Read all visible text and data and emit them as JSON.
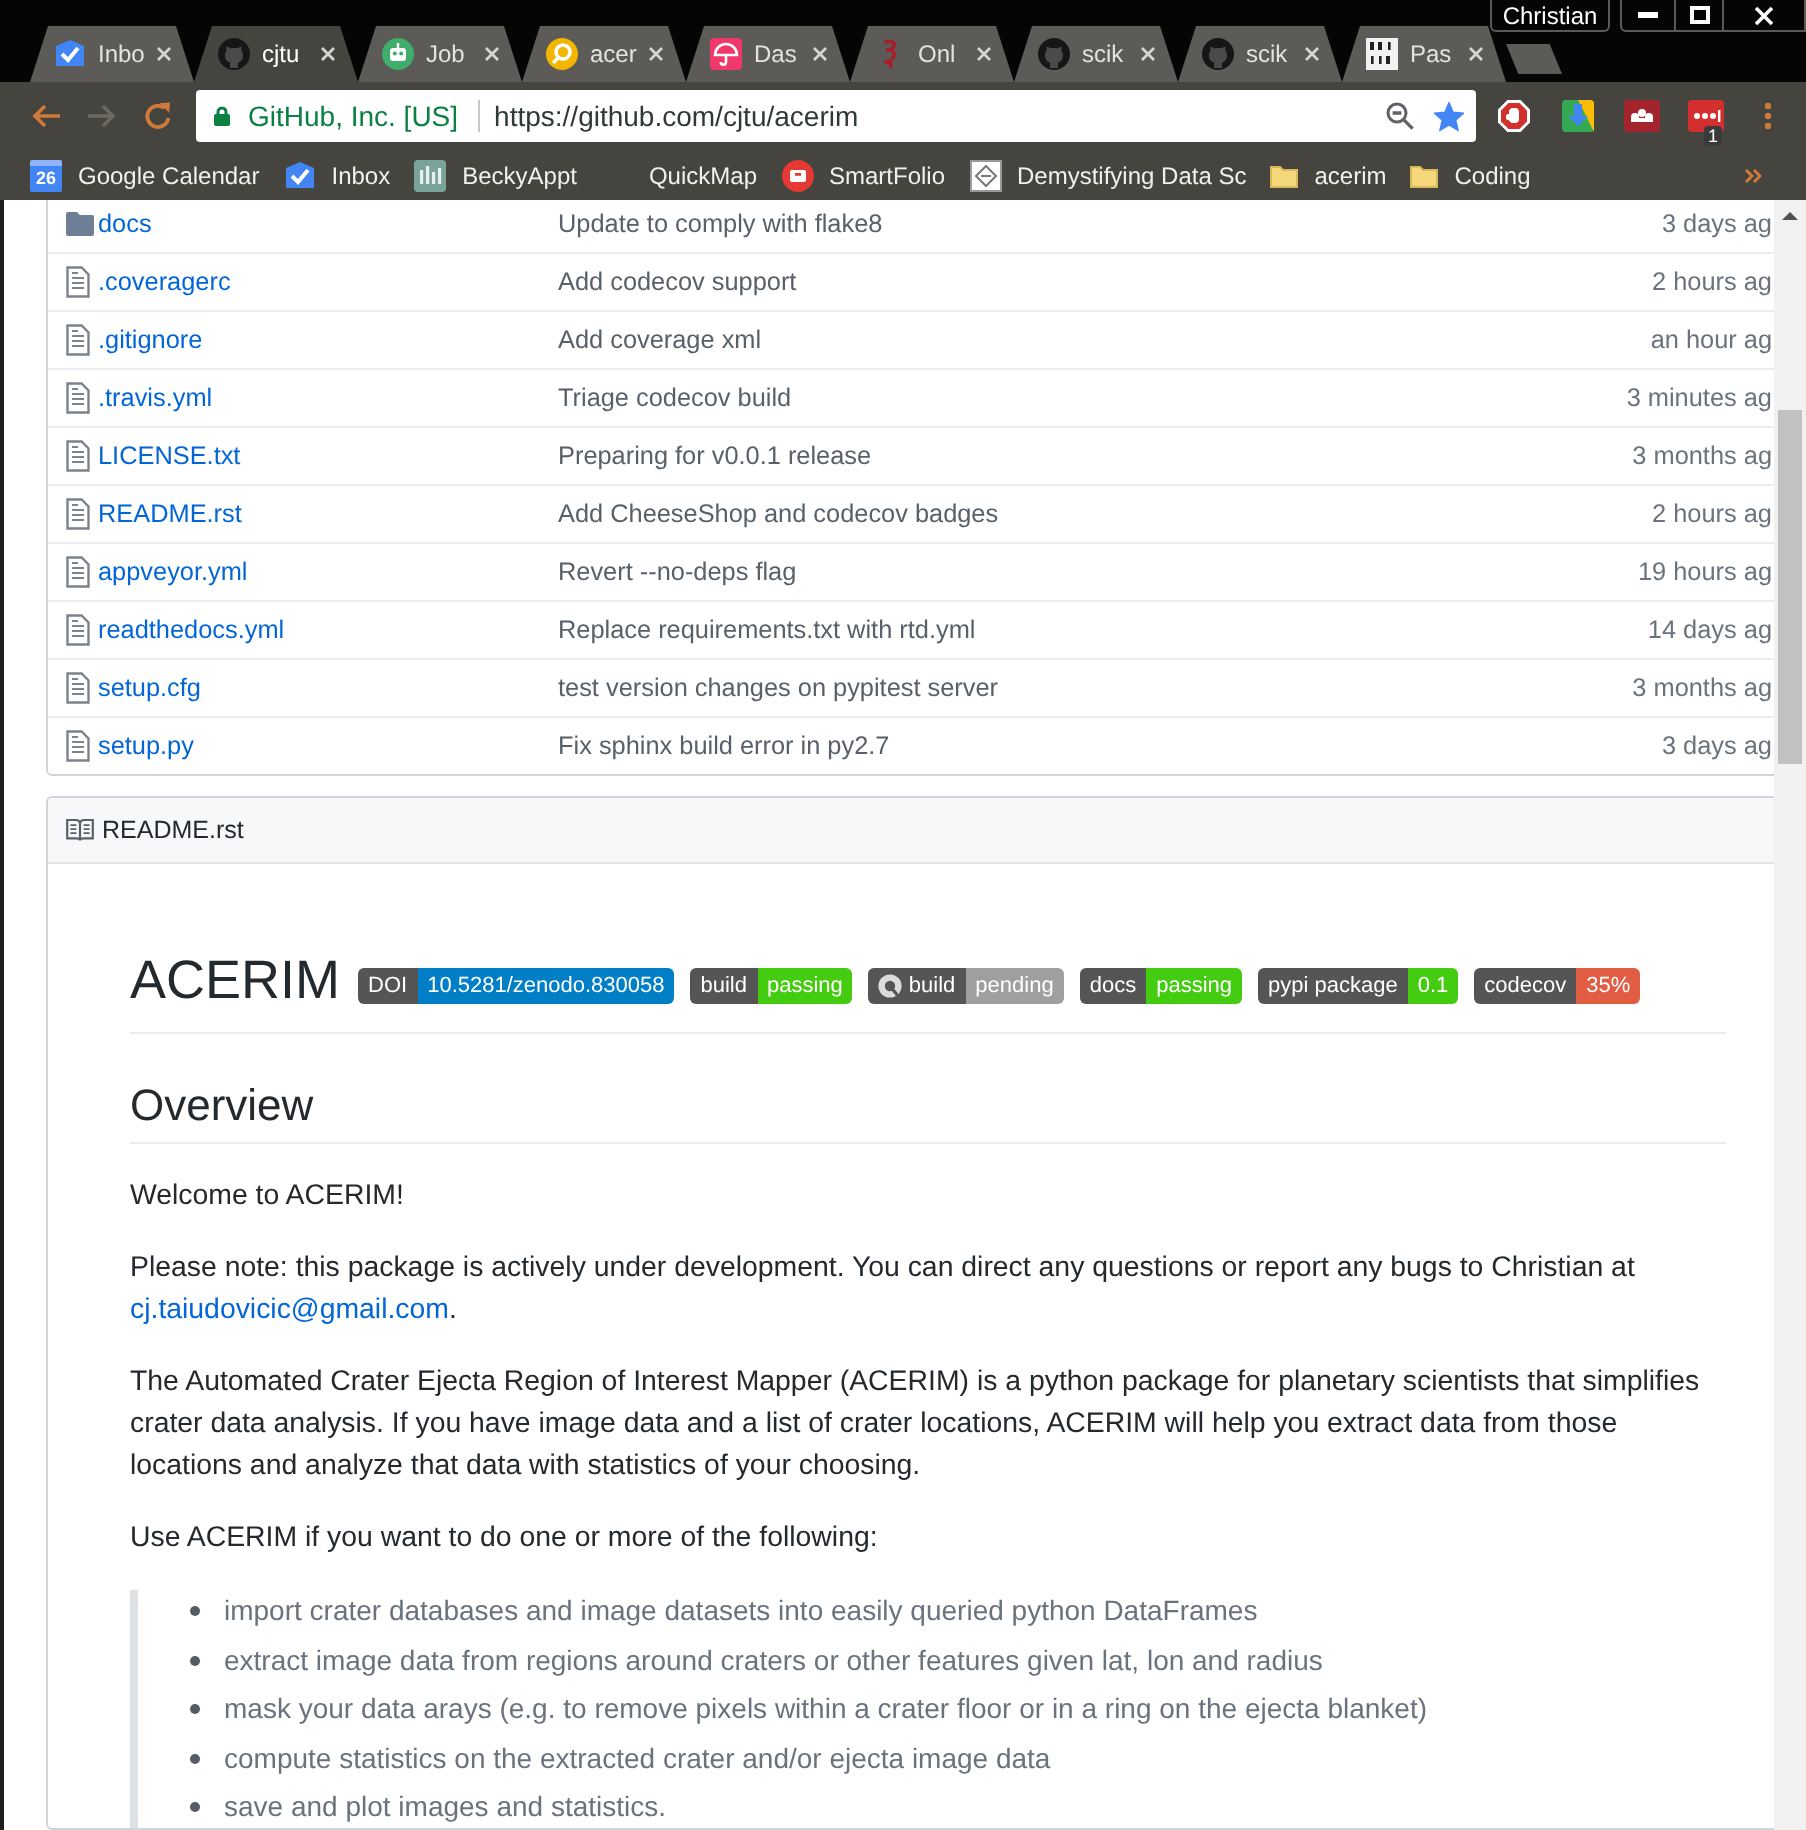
{
  "window": {
    "profile": "Christian"
  },
  "tabs": [
    {
      "title": "Inbo",
      "kind": "mail",
      "selected": false
    },
    {
      "title": "cjtu",
      "kind": "cat",
      "selected": true
    },
    {
      "title": "Job",
      "kind": "robot",
      "selected": false
    },
    {
      "title": "acer",
      "kind": "ring",
      "selected": false
    },
    {
      "title": "Das",
      "kind": "umbrella",
      "selected": false
    },
    {
      "title": "Onl",
      "kind": "squiggle",
      "selected": false
    },
    {
      "title": "scik",
      "kind": "cat",
      "selected": false
    },
    {
      "title": "scik",
      "kind": "cat",
      "selected": false
    },
    {
      "title": "Pas",
      "kind": "blocks",
      "selected": false
    }
  ],
  "nav_buttons": [
    {
      "kind": "back",
      "disabled": false
    },
    {
      "kind": "forward",
      "disabled": true
    },
    {
      "kind": "reload",
      "disabled": false
    }
  ],
  "address_bar": {
    "identity": "GitHub, Inc. [US]",
    "url": "https://github.com/cjtu/acerim",
    "bookmarked": true
  },
  "extensions": [
    {
      "kind": "stop"
    },
    {
      "kind": "download"
    },
    {
      "kind": "tile"
    },
    {
      "kind": "dots",
      "badge": "1"
    }
  ],
  "bookmarks": [
    {
      "label": "Google Calendar",
      "kind": "calendar",
      "icon_text": "26"
    },
    {
      "label": "Inbox",
      "kind": "mail"
    },
    {
      "label": "BeckyAppt",
      "kind": "bars"
    },
    {
      "label": "QuickMap",
      "kind": "none"
    },
    {
      "label": "SmartFolio",
      "kind": "seal"
    },
    {
      "label": "Demystifying Data Sc",
      "kind": "page"
    },
    {
      "label": "acerim",
      "kind": "folder"
    },
    {
      "label": "Coding",
      "kind": "folder"
    }
  ],
  "files": [
    {
      "kind": "folder",
      "name": "docs",
      "message": "Update to comply with flake8",
      "age": "3 days ag"
    },
    {
      "kind": "file",
      "name": ".coveragerc",
      "message": "Add codecov support",
      "age": "2 hours ag"
    },
    {
      "kind": "file",
      "name": ".gitignore",
      "message": "Add coverage xml",
      "age": "an hour ag"
    },
    {
      "kind": "file",
      "name": ".travis.yml",
      "message": "Triage codecov build",
      "age": "3 minutes ag"
    },
    {
      "kind": "file",
      "name": "LICENSE.txt",
      "message": "Preparing for v0.0.1 release",
      "age": "3 months ag"
    },
    {
      "kind": "file",
      "name": "README.rst",
      "message": "Add CheeseShop and codecov badges",
      "age": "2 hours ag"
    },
    {
      "kind": "file",
      "name": "appveyor.yml",
      "message": "Revert --no-deps flag",
      "age": "19 hours ag"
    },
    {
      "kind": "file",
      "name": "readthedocs.yml",
      "message": "Replace requirements.txt with rtd.yml",
      "age": "14 days ag"
    },
    {
      "kind": "file",
      "name": "setup.cfg",
      "message": "test version changes on pypitest server",
      "age": "3 months ag"
    },
    {
      "kind": "file",
      "name": "setup.py",
      "message": "Fix sphinx build error in py2.7",
      "age": "3 days ag"
    }
  ],
  "readme": {
    "filename": "README.rst",
    "title": "ACERIM",
    "badges": [
      {
        "label": "DOI",
        "value": "10.5281/zenodo.830058",
        "color": "#007ec6",
        "logo": false
      },
      {
        "label": "build",
        "value": "passing",
        "color": "#44cc11",
        "logo": false
      },
      {
        "label": "build",
        "value": "pending",
        "color": "#9f9f9f",
        "logo": true
      },
      {
        "label": "docs",
        "value": "passing",
        "color": "#44cc11",
        "logo": false
      },
      {
        "label": "pypi package",
        "value": "0.1",
        "color": "#44cc11",
        "logo": false
      },
      {
        "label": "codecov",
        "value": "35%",
        "color": "#e05d44",
        "logo": false
      }
    ],
    "heading": "Overview",
    "paragraphs": [
      {
        "text": "Welcome to ACERIM!"
      },
      {
        "text": "Please note: this package is actively under development. You can direct any questions or report any bugs to Christian at",
        "link": "cj.taiudovicic@gmail.com",
        "after": "."
      },
      {
        "text": "The Automated Crater Ejecta Region of Interest Mapper (ACERIM) is a python package for planetary scientists that simplifies crater data analysis. If you have image data and a list of crater locations, ACERIM will help you extract data from those locations and analyze that data with statistics of your choosing."
      },
      {
        "text": "Use ACERIM if you want to do one or more of the following:"
      }
    ],
    "list": [
      "import crater databases and image datasets into easily queried python DataFrames",
      "extract image data from regions around craters or other features given lat, lon and radius",
      "mask your data arays (e.g. to remove pixels within a crater floor or in a ring on the ejecta blanket)",
      "compute statistics on the extracted crater and/or ejecta image data",
      "save and plot images and statistics."
    ]
  }
}
